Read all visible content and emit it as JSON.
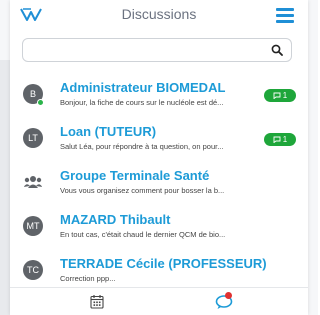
{
  "header": {
    "title": "Discussions"
  },
  "search": {
    "value": "",
    "placeholder": ""
  },
  "conversations": [
    {
      "initials": "B",
      "name": "Administrateur BIOMEDAL",
      "snippet": "Bonjour, la fiche de cours sur le nucléole est dé...",
      "unread": "1",
      "online": true
    },
    {
      "initials": "LT",
      "name": "Loan (TUTEUR)",
      "snippet": "Salut Léa, pour répondre à ta question, on pour...",
      "unread": "1",
      "online": false
    },
    {
      "initials": "",
      "name": "Groupe Terminale Santé",
      "snippet": "Vous vous organisez comment pour bosser la b...",
      "unread": "",
      "online": false
    },
    {
      "initials": "MT",
      "name": "MAZARD Thibault",
      "snippet": "En tout cas, c'était chaud le dernier QCM de bio...",
      "unread": "",
      "online": false
    },
    {
      "initials": "TC",
      "name": "TERRADE Cécile (PROFESSEUR)",
      "snippet": "Correction ppp...",
      "unread": "",
      "online": false
    }
  ],
  "colors": {
    "accent": "#1d9bd7",
    "badge": "#1ea63a",
    "notification": "#e03131"
  },
  "icons": {
    "logo": "app-logo",
    "menu": "hamburger-icon",
    "search": "search-icon",
    "calendar": "calendar-icon",
    "chat": "chat-icon"
  }
}
